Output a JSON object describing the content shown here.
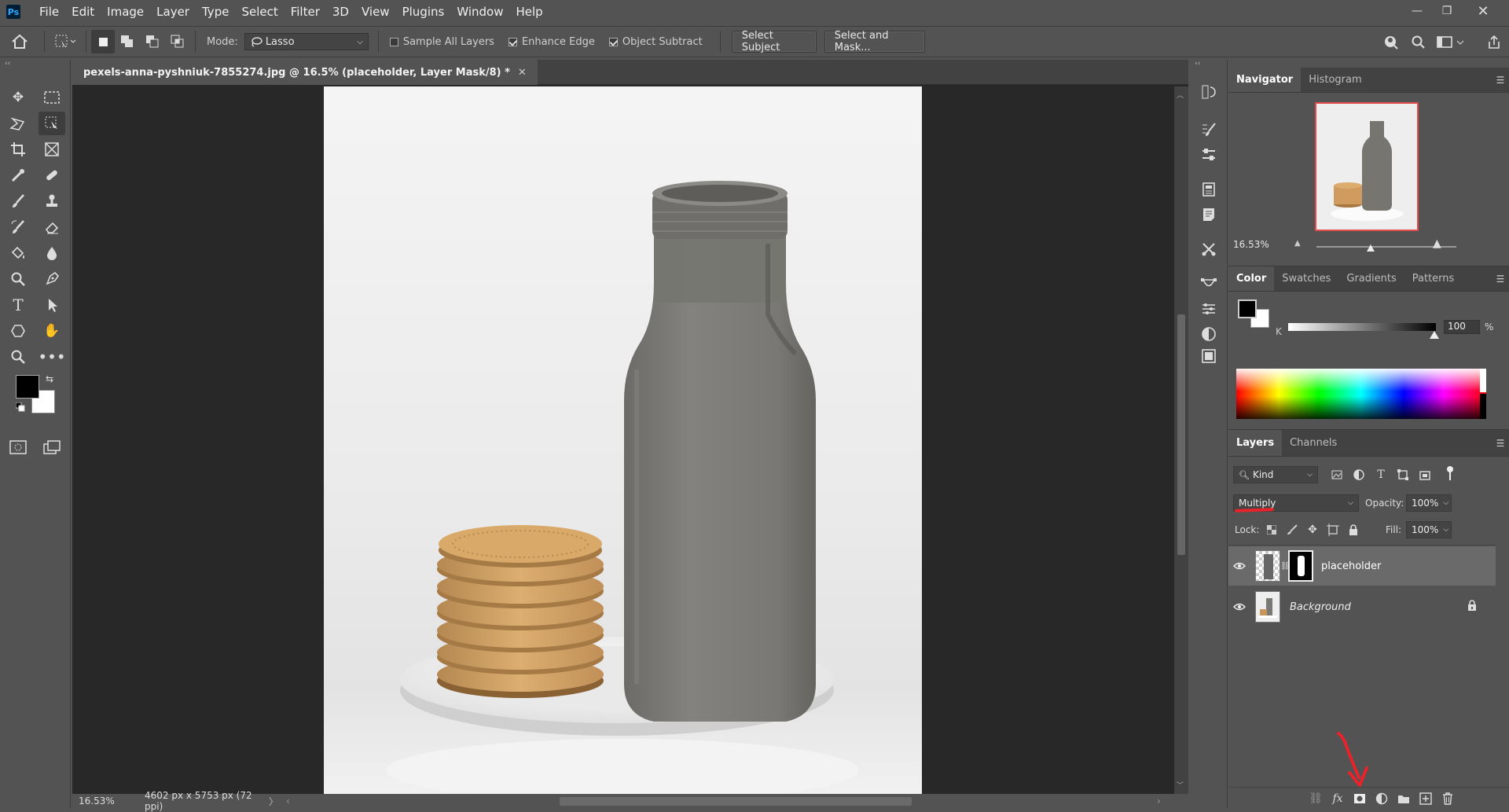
{
  "app": {
    "logo": "Ps"
  },
  "menu": [
    "File",
    "Edit",
    "Image",
    "Layer",
    "Type",
    "Select",
    "Filter",
    "3D",
    "View",
    "Plugins",
    "Window",
    "Help"
  ],
  "options": {
    "mode_label": "Mode:",
    "mode_value": "Lasso",
    "sample_all_layers": {
      "label": "Sample All Layers",
      "checked": false
    },
    "enhance_edge": {
      "label": "Enhance Edge",
      "checked": true
    },
    "object_subtract": {
      "label": "Object Subtract",
      "checked": true
    },
    "select_subject": "Select Subject",
    "select_and_mask": "Select and Mask..."
  },
  "document": {
    "tab_title": "pexels-anna-pyshniuk-7855274.jpg @ 16.5% (placeholder, Layer Mask/8) *",
    "zoom": "16.53%",
    "size_info": "4602 px x 5753 px (72 ppi)"
  },
  "navigator": {
    "tabs": [
      "Navigator",
      "Histogram"
    ],
    "zoom": "16.53%"
  },
  "color": {
    "tabs": [
      "Color",
      "Swatches",
      "Gradients",
      "Patterns"
    ],
    "channel_label": "K",
    "value": "100",
    "unit": "%",
    "foreground": "#000000",
    "background": "#ffffff"
  },
  "layers": {
    "tabs": [
      "Layers",
      "Channels"
    ],
    "filter_kind": "Kind",
    "blend_mode": "Multiply",
    "opacity_label": "Opacity:",
    "opacity_value": "100%",
    "lock_label": "Lock:",
    "fill_label": "Fill:",
    "fill_value": "100%",
    "items": [
      {
        "name": "placeholder",
        "selected": true,
        "has_mask": true
      },
      {
        "name": "Background",
        "selected": false,
        "locked": true
      }
    ]
  },
  "colors": {
    "ui_bg": "#535353",
    "panel_dark": "#424242",
    "canvas_bg": "#282828",
    "annotation_red": "#e8232a"
  }
}
